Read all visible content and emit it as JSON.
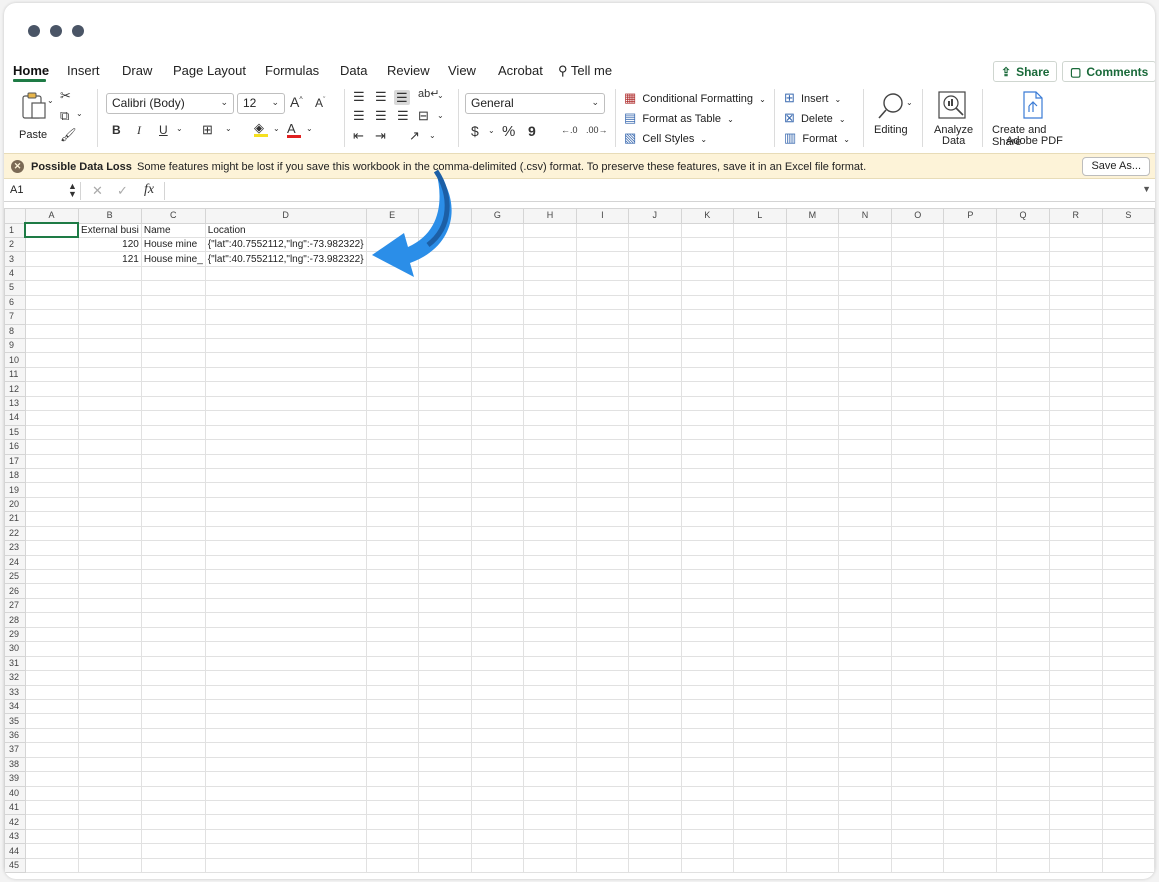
{
  "ribbon_tabs": [
    "Home",
    "Insert",
    "Draw",
    "Page Layout",
    "Formulas",
    "Data",
    "Review",
    "View",
    "Acrobat"
  ],
  "tell_me": "Tell me",
  "share_label": "Share",
  "comments_label": "Comments",
  "clipboard": {
    "paste_label": "Paste"
  },
  "font": {
    "name": "Calibri (Body)",
    "size": "12",
    "bold": "B",
    "italic": "I",
    "underline": "U"
  },
  "number": {
    "format": "General",
    "currency": "$",
    "percent": "%",
    "comma": "9"
  },
  "styles": {
    "conditional": "Conditional Formatting",
    "format_table": "Format as Table",
    "cell_styles": "Cell Styles"
  },
  "cells": {
    "insert": "Insert",
    "delete": "Delete",
    "format": "Format"
  },
  "editing_label": "Editing",
  "analyze": {
    "line1": "Analyze",
    "line2": "Data"
  },
  "adobe": {
    "line1": "Create and Share",
    "line2": "Adobe PDF"
  },
  "message_bar": {
    "title": "Possible Data Loss",
    "text": "Some features might be lost if you save this workbook in the comma-delimited (.csv) format. To preserve these features, save it in an Excel file format.",
    "button": "Save As..."
  },
  "formula_bar": {
    "name_box": "A1",
    "fx": "fx",
    "value": ""
  },
  "sheet": {
    "columns": [
      "A",
      "B",
      "C",
      "D",
      "E",
      "F",
      "G",
      "H",
      "I",
      "J",
      "K",
      "L",
      "M",
      "N",
      "O",
      "P",
      "Q",
      "R",
      "S"
    ],
    "row_count": 45,
    "selected_cell": "A1",
    "cells": {
      "B1": "External busi",
      "C1": "Name",
      "D1": "Location",
      "B2": "120",
      "C2": "House mine",
      "D2": "{\"lat\":40.7552112,\"lng\":-73.982322}",
      "B3": "121",
      "C3": "House mine_",
      "D3": "{\"lat\":40.7552112,\"lng\":-73.982322}"
    },
    "numeric_cells": [
      "B2",
      "B3"
    ]
  },
  "colors": {
    "accent": "#1e7b45",
    "arrow": "#2b8ee8",
    "message_bg": "#fdf3d8"
  }
}
